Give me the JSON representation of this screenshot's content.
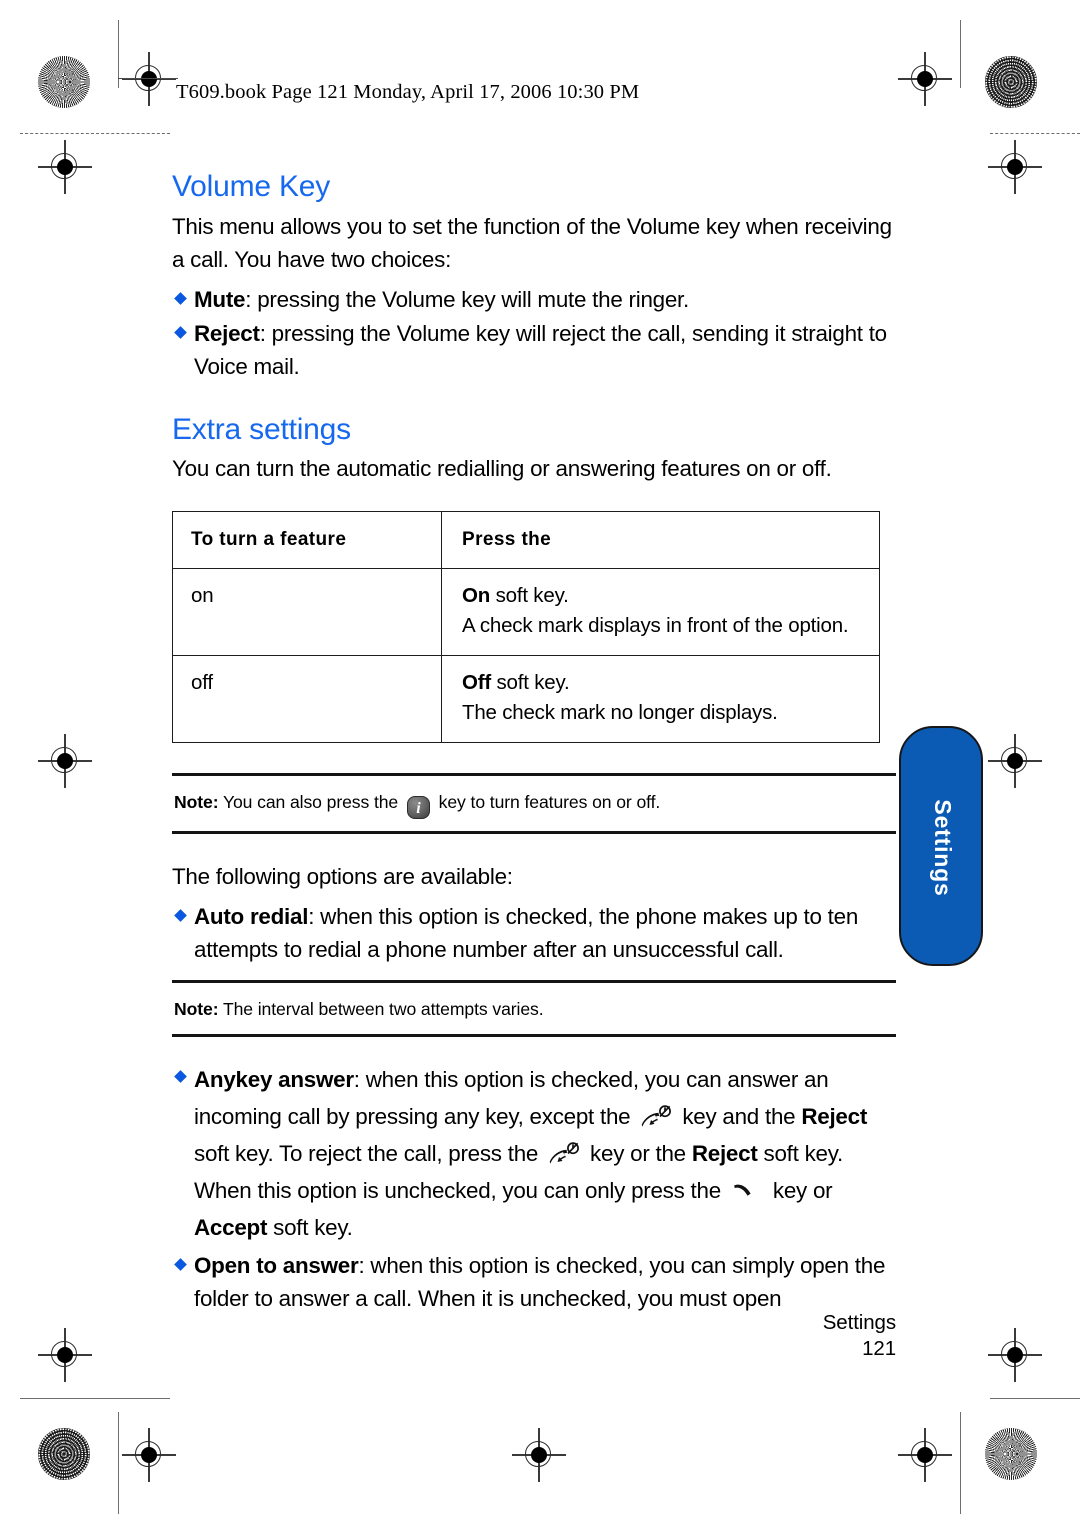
{
  "document": {
    "running_head": "T609.book  Page 121  Monday, April 17, 2006  10:30 PM",
    "side_tab_label": "Settings",
    "footer": {
      "chapter": "Settings",
      "page_number": "121"
    }
  },
  "sections": [
    {
      "title": "Volume Key",
      "intro": "This menu allows you to set the function of the Volume key when receiving a call. You have two choices:",
      "bullets": [
        {
          "term": "Mute",
          "rest": ": pressing the Volume key will mute the ringer."
        },
        {
          "term": "Reject",
          "rest": ": pressing the Volume key will reject the call, sending it straight to Voice mail."
        }
      ]
    },
    {
      "title": "Extra settings",
      "intro": "You can turn the automatic redialling or answering features on or off."
    }
  ],
  "table": {
    "headers": [
      "To turn a feature",
      "Press the"
    ],
    "rows": [
      {
        "feature": "on",
        "action_key": "On",
        "action_rest": " soft key.",
        "action_detail": "A check mark displays in front of the option."
      },
      {
        "feature": "off",
        "action_key": "Off",
        "action_rest": " soft key.",
        "action_detail": "The check mark no longer displays."
      }
    ]
  },
  "notes": [
    {
      "label": "Note:",
      "text_before": " You can also press the ",
      "icon": "info-key-icon",
      "icon_glyph": "i",
      "text_after": " key to turn features on or off."
    },
    {
      "label": "Note:",
      "text_before": " The interval between two attempts varies.",
      "icon": null,
      "icon_glyph": "",
      "text_after": ""
    }
  ],
  "options_intro": "The following options are available:",
  "options": [
    {
      "term": "Auto redial",
      "rest": ": when this option is checked, the phone makes up to ten attempts to redial a phone number after an unsuccessful call."
    },
    {
      "term": "Anykey answer",
      "segments": {
        "s1": ": when this option is checked, you can answer an incoming call by pressing any key, except the ",
        "icon1": "end-call-key-icon",
        "s2": " key and the ",
        "b1": "Reject",
        "s3": " soft key. To reject the call, press the ",
        "icon2": "end-call-key-icon",
        "s4": " key or the ",
        "b2": "Reject",
        "s5": " soft key. When this option is unchecked, you can only press the ",
        "icon3": "send-call-key-icon",
        "s6": " key or ",
        "b3": "Accept",
        "s7": " soft key."
      }
    },
    {
      "term": "Open to answer",
      "rest": ": when this option is checked, you can simply open the folder to answer a call. When it is unchecked, you must open"
    }
  ],
  "colors": {
    "heading_blue": "#1668ef",
    "bullet_blue": "#0a58e0",
    "tab_blue": "#0b5bb5",
    "rule_black": "#141414"
  }
}
